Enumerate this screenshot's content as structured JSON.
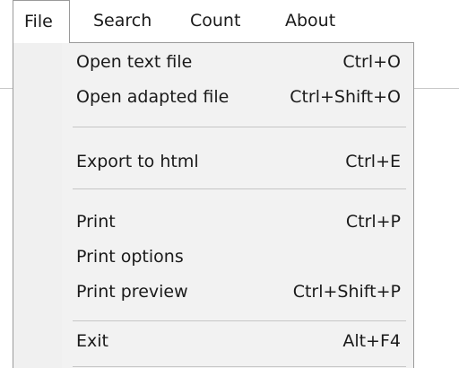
{
  "menubar": {
    "items": [
      {
        "label": "File"
      },
      {
        "label": "Search"
      },
      {
        "label": "Count"
      },
      {
        "label": "About"
      }
    ]
  },
  "file_menu": {
    "groups": [
      [
        {
          "label": "Open text file",
          "shortcut": "Ctrl+O"
        },
        {
          "label": "Open adapted file",
          "shortcut": "Ctrl+Shift+O"
        }
      ],
      [
        {
          "label": "Export to html",
          "shortcut": "Ctrl+E"
        }
      ],
      [
        {
          "label": "Print",
          "shortcut": "Ctrl+P"
        },
        {
          "label": "Print options",
          "shortcut": ""
        },
        {
          "label": "Print preview",
          "shortcut": "Ctrl+Shift+P"
        }
      ],
      [
        {
          "label": "Exit",
          "shortcut": "Alt+F4"
        }
      ]
    ]
  }
}
